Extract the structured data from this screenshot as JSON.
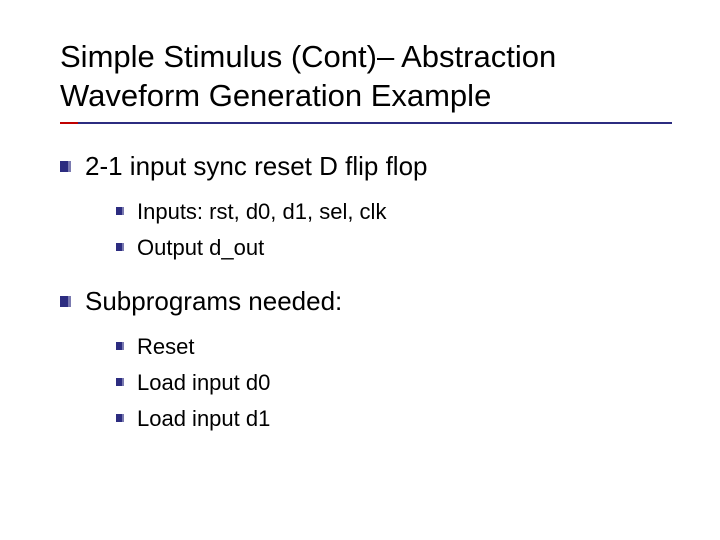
{
  "title": "Simple Stimulus (Cont)– Abstraction Waveform Generation Example",
  "items": [
    {
      "text": "2-1 input sync reset D flip flop",
      "sub": [
        "Inputs: rst, d0, d1, sel, clk",
        "Output d_out"
      ]
    },
    {
      "text": "Subprograms needed:",
      "sub": [
        "Reset",
        "Load input d0",
        "Load input d1"
      ]
    }
  ]
}
